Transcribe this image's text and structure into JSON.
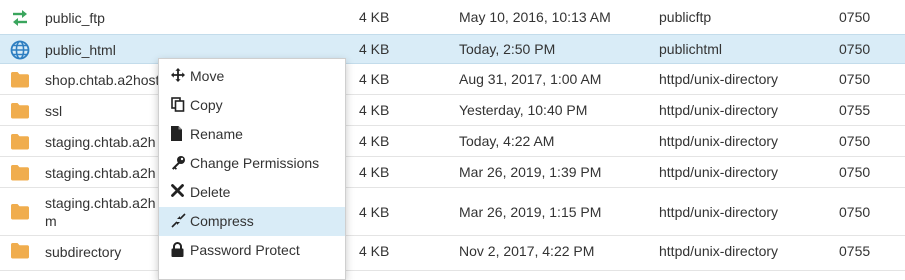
{
  "files": [
    {
      "name": "public_ftp",
      "size": "4 KB",
      "modified": "May 10, 2016, 10:13 AM",
      "type": "publicftp",
      "perms": "0750",
      "icon": "arrows-icon"
    },
    {
      "name": "public_html",
      "size": "4 KB",
      "modified": "Today, 2:50 PM",
      "type": "publichtml",
      "perms": "0750",
      "icon": "globe-icon"
    },
    {
      "name": "shop.chtab.a2host",
      "size": "4 KB",
      "modified": "Aug 31, 2017, 1:00 AM",
      "type": "httpd/unix-directory",
      "perms": "0750",
      "icon": "folder-icon"
    },
    {
      "name": "ssl",
      "size": "4 KB",
      "modified": "Yesterday, 10:40 PM",
      "type": "httpd/unix-directory",
      "perms": "0755",
      "icon": "folder-icon"
    },
    {
      "name": "staging.chtab.a2h",
      "size": "4 KB",
      "modified": "Today, 4:22 AM",
      "type": "httpd/unix-directory",
      "perms": "0750",
      "icon": "folder-icon"
    },
    {
      "name": "staging.chtab.a2h",
      "size": "4 KB",
      "modified": "Mar 26, 2019, 1:39 PM",
      "type": "httpd/unix-directory",
      "perms": "0750",
      "icon": "folder-icon"
    },
    {
      "name": "staging.chtab.a2h\nm",
      "size": "4 KB",
      "modified": "Mar 26, 2019, 1:15 PM",
      "type": "httpd/unix-directory",
      "perms": "0750",
      "icon": "folder-icon"
    },
    {
      "name": "subdirectory",
      "size": "4 KB",
      "modified": "Nov 2, 2017, 4:22 PM",
      "type": "httpd/unix-directory",
      "perms": "0755",
      "icon": "folder-icon"
    }
  ],
  "context_menu": {
    "items": [
      {
        "label": "Move",
        "icon": "move-icon"
      },
      {
        "label": "Copy",
        "icon": "copy-icon"
      },
      {
        "label": "Rename",
        "icon": "file-icon"
      },
      {
        "label": "Change Permissions",
        "icon": "key-icon"
      },
      {
        "label": "Delete",
        "icon": "close-icon"
      },
      {
        "label": "Compress",
        "icon": "compress-icon"
      },
      {
        "label": "Password Protect",
        "icon": "lock-icon"
      }
    ]
  },
  "colors": {
    "folder": "#f0ad4e",
    "globe": "#2f7fc1",
    "arrows": "#3aa55d",
    "selected_row": "#d9ecf7"
  }
}
